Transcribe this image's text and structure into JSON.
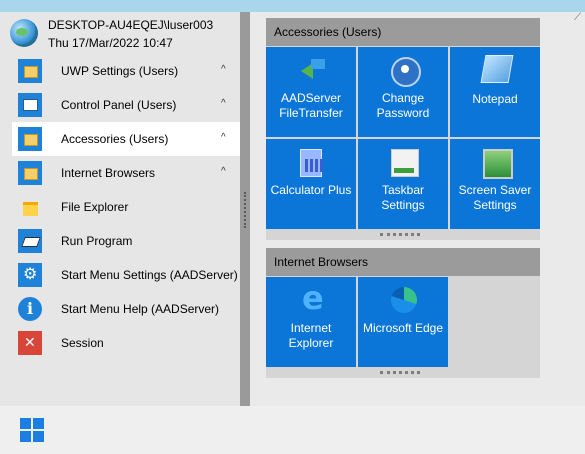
{
  "user": {
    "line1": "DESKTOP-AU4EQEJ\\luser003",
    "line2": "Thu 17/Mar/2022 10:47"
  },
  "menu": [
    {
      "label": "UWP Settings (Users)",
      "chevron": "^",
      "icon": "folder-icon"
    },
    {
      "label": "Control Panel (Users)",
      "chevron": "^",
      "icon": "control-panel-icon"
    },
    {
      "label": "Accessories (Users)",
      "chevron": "^",
      "icon": "folder-icon",
      "selected": true
    },
    {
      "label": "Internet Browsers",
      "chevron": "^",
      "icon": "folder-icon"
    },
    {
      "label": "File Explorer",
      "icon": "file-explorer-icon"
    },
    {
      "label": "Run Program",
      "icon": "run-program-icon"
    },
    {
      "label": "Start Menu Settings (AADServer)",
      "icon": "settings-icon"
    },
    {
      "label": "Start Menu Help (AADServer)",
      "icon": "info-icon"
    },
    {
      "label": "Session",
      "icon": "session-icon"
    }
  ],
  "groups": [
    {
      "title": "Accessories (Users)",
      "tiles": [
        {
          "line1": "AADServer",
          "line2": "FileTransfer",
          "icon": "file-transfer-icon"
        },
        {
          "line1": "Change",
          "line2": "Password",
          "icon": "key-icon"
        },
        {
          "line1": "Notepad",
          "line2": "",
          "icon": "notepad-icon"
        },
        {
          "line1": "Calculator Plus",
          "line2": "",
          "icon": "calculator-icon"
        },
        {
          "line1": "Taskbar",
          "line2": "Settings",
          "icon": "taskbar-icon"
        },
        {
          "line1": "Screen Saver",
          "line2": "Settings",
          "icon": "screen-saver-icon"
        }
      ]
    },
    {
      "title": "Internet Browsers",
      "tiles": [
        {
          "line1": "Internet",
          "line2": "Explorer",
          "icon": "internet-explorer-icon"
        },
        {
          "line1": "Microsoft Edge",
          "line2": "",
          "icon": "edge-icon"
        }
      ]
    }
  ],
  "colors": {
    "tile": "#0b76d8",
    "desktop": "#a9d6ea",
    "group_header": "#9b9b9b"
  }
}
